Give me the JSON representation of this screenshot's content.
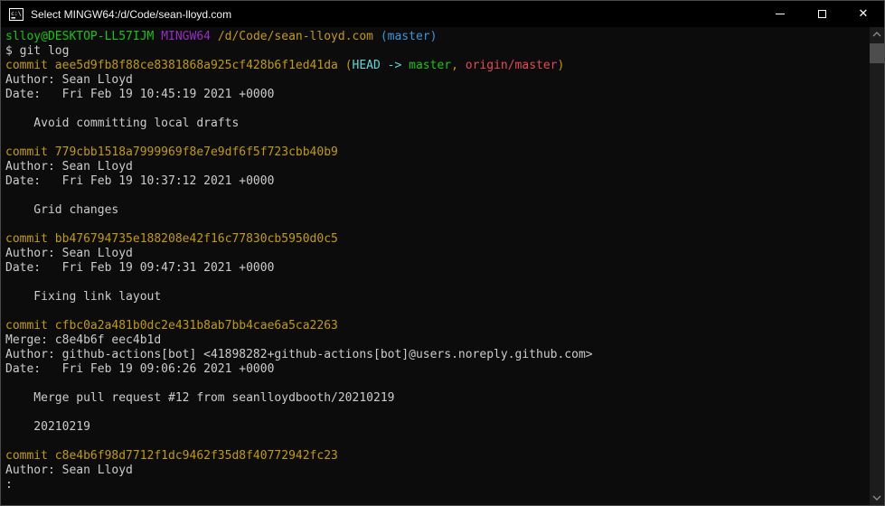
{
  "window": {
    "title": "Select MINGW64:/d/Code/sean-lloyd.com",
    "icon": "console-icon",
    "controls": {
      "minimize": "minimize",
      "maximize": "maximize",
      "close": "✕"
    }
  },
  "palette": {
    "bg": "#0C0C0C",
    "fg": "#CCCCCC",
    "green": "#16C60C",
    "purple": "#9A2BC6",
    "yellow": "#C19C00",
    "cyan": "#3A96DD",
    "brightCyan": "#61D6D6",
    "red": "#E74856",
    "titlebarBg": "#000000",
    "titleFg": "#F2F2F2",
    "scrollTrack": "#1C1C1C",
    "scrollThumb": "#4D4D4D",
    "scrollArrow": "#8A8A8A"
  },
  "terminal": {
    "lines": [
      [
        {
          "t": "slloy@DESKTOP-LL57IJM ",
          "c": "green"
        },
        {
          "t": "MINGW64 ",
          "c": "purple"
        },
        {
          "t": "/d/Code/sean-lloyd.com ",
          "c": "yellow"
        },
        {
          "t": "(master)",
          "c": "cyan"
        }
      ],
      [
        {
          "t": "$ git log",
          "c": "fg"
        }
      ],
      [
        {
          "t": "commit aee5d9fb8f88ce8381868a925cf428b6f1ed41da ",
          "c": "yellow"
        },
        {
          "t": "(",
          "c": "yellow"
        },
        {
          "t": "HEAD -> ",
          "c": "brightCyan"
        },
        {
          "t": "master",
          "c": "green"
        },
        {
          "t": ", ",
          "c": "yellow"
        },
        {
          "t": "origin/master",
          "c": "red"
        },
        {
          "t": ")",
          "c": "yellow"
        }
      ],
      [
        {
          "t": "Author: Sean Lloyd",
          "c": "fg"
        }
      ],
      [
        {
          "t": "Date:   Fri Feb 19 10:45:19 2021 +0000",
          "c": "fg"
        }
      ],
      [],
      [
        {
          "t": "    Avoid committing local drafts",
          "c": "fg"
        }
      ],
      [],
      [
        {
          "t": "commit 779cbb1518a7999969f8e7e9df6f5f723cbb40b9",
          "c": "yellow"
        }
      ],
      [
        {
          "t": "Author: Sean Lloyd",
          "c": "fg"
        }
      ],
      [
        {
          "t": "Date:   Fri Feb 19 10:37:12 2021 +0000",
          "c": "fg"
        }
      ],
      [],
      [
        {
          "t": "    Grid changes",
          "c": "fg"
        }
      ],
      [],
      [
        {
          "t": "commit bb476794735e188208e42f16c77830cb5950d0c5",
          "c": "yellow"
        }
      ],
      [
        {
          "t": "Author: Sean Lloyd",
          "c": "fg"
        }
      ],
      [
        {
          "t": "Date:   Fri Feb 19 09:47:31 2021 +0000",
          "c": "fg"
        }
      ],
      [],
      [
        {
          "t": "    Fixing link layout",
          "c": "fg"
        }
      ],
      [],
      [
        {
          "t": "commit cfbc0a2a481b0dc2e431b8ab7bb4cae6a5ca2263",
          "c": "yellow"
        }
      ],
      [
        {
          "t": "Merge: c8e4b6f eec4b1d",
          "c": "fg"
        }
      ],
      [
        {
          "t": "Author: github-actions[bot] <41898282+github-actions[bot]@users.noreply.github.com>",
          "c": "fg"
        }
      ],
      [
        {
          "t": "Date:   Fri Feb 19 09:06:26 2021 +0000",
          "c": "fg"
        }
      ],
      [],
      [
        {
          "t": "    Merge pull request #12 from seanlloydbooth/20210219",
          "c": "fg"
        }
      ],
      [],
      [
        {
          "t": "    20210219",
          "c": "fg"
        }
      ],
      [],
      [
        {
          "t": "commit c8e4b6f98d7712f1dc9462f35d8f40772942fc23",
          "c": "yellow"
        }
      ],
      [
        {
          "t": "Author: Sean Lloyd",
          "c": "fg"
        }
      ],
      [
        {
          "t": ":",
          "c": "fg"
        }
      ]
    ]
  }
}
